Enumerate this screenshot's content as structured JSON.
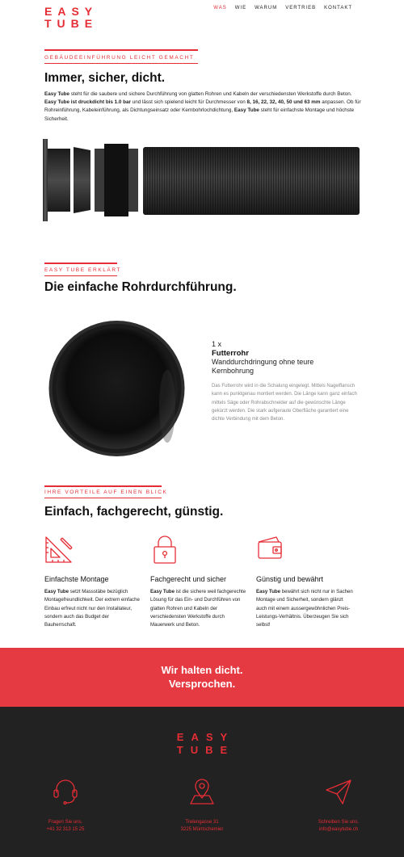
{
  "colors": {
    "accent": "#e52d35",
    "banner": "#e63a42",
    "footer": "#222222"
  },
  "header": {
    "logo_line1": "EASY",
    "logo_line2": "TUBE",
    "nav": [
      "WAS",
      "WIE",
      "WARUM",
      "VERTRIEB",
      "KONTAKT"
    ],
    "nav_active": "WAS"
  },
  "intro": {
    "label": "GEBÄUDEEINFÜHRUNG LEICHT GEMACHT",
    "heading": "Immer, sicher, dicht.",
    "p1": "Easy Tube",
    "p2": " steht für die saubere und sichere Durchführung von glatten Rohren und Kabeln der verschiedensten Werkstoffe durch Beton. ",
    "p3": "Easy Tube ist druckdicht bis 1.0 bar",
    "p4": " und lässt sich spielend leicht für Durchmesser von ",
    "p5": "8, 16, 22, 32, 40, 50 und 63 mm",
    "p6": " anpassen. Ob für Rohreinführung, Kabeleinführung, als Dichtungseinsatz oder Kernbohrlochdichtung, ",
    "p7": "Easy Tube",
    "p8": " steht für einfachste Montage und höchste Sicherheit."
  },
  "explain": {
    "label": "EASY TUBE ERKLÄRT",
    "heading": "Die einfache Rohrdurchführung.",
    "qty": "1 x",
    "product": "Futterrohr",
    "subtitle": "Wanddurchdringung ohne teure Kernbohrung",
    "description": "Das Futterrohr wird in die Schalung eingelegt. Mittels Nagelflansch kann es punktgenau montiert werden. Die Länge kann ganz einfach mittels Säge oder Rohrabschneider auf die gewünschte Länge gekürzt werden. Die stark aufgeraute Oberfläche garantiert eine dichte Verbindung mit dem Beton."
  },
  "benefits": {
    "label": "IHRE VORTEILE AUF EINEN BLICK",
    "heading": "Einfach, fachgerecht, günstig.",
    "items": [
      {
        "icon": "ruler-triangle-icon",
        "title": "Einfachste Montage",
        "bold": "Easy Tube",
        "text": " setzt Massstäbe bezüglich Montagefreundlichkeit. Der extrem einfache Einbau erfreut nicht nur den Installateur, sondern auch das Budget der Bauherrschaft."
      },
      {
        "icon": "lock-icon",
        "title": "Fachgerecht und sicher",
        "bold": "Easy Tube",
        "text": " ist die sichere weil fachgerechte Lösung für das Ein- und Durchführen von glatten Rohren und Kabeln der verschiedensten Werkstoffe durch Mauerwerk und Beton."
      },
      {
        "icon": "wallet-icon",
        "title": "Günstig und bewährt",
        "bold": "Easy Tube",
        "text": " bewährt sich nicht nur in Sachen Montage und Sicherheit, sondern glänzt auch mit einem aussergewöhnlichen Preis-Leistungs-Verhältnis. Überzeugen Sie sich selbst!"
      }
    ]
  },
  "banner": {
    "line1": "Wir halten dicht.",
    "line2": "Versprochen."
  },
  "footer": {
    "logo_line1": "EASY",
    "logo_line2": "TUBE",
    "contacts": [
      {
        "icon": "headset-icon",
        "line1": "Fragen Sie uns.",
        "line2": "+41 32 313 15 25"
      },
      {
        "icon": "map-pin-icon",
        "line1": "Trelengasse 31",
        "line2": "3225 Müntschemier"
      },
      {
        "icon": "paper-plane-icon",
        "line1": "Schreiben Sie uns.",
        "line2": "info@easytube.ch"
      }
    ]
  }
}
